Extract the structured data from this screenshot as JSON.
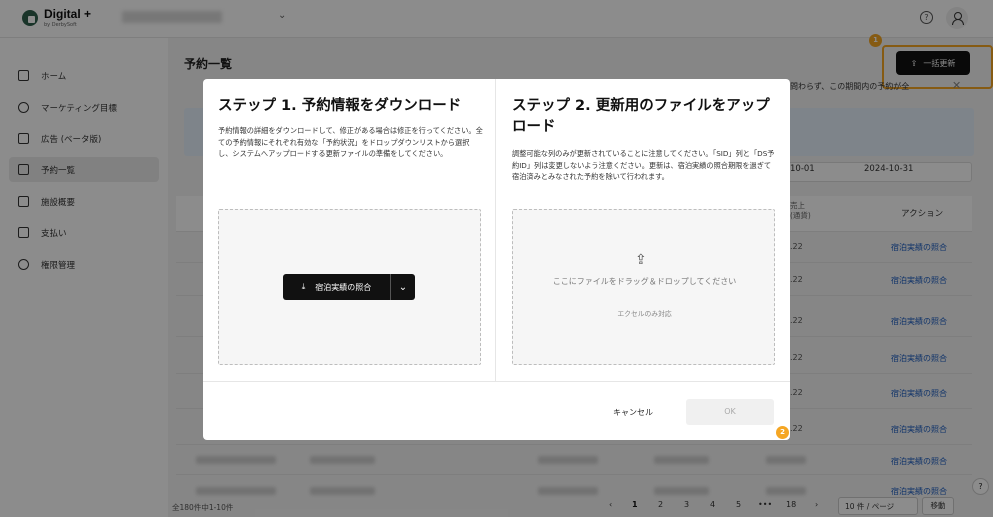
{
  "app": {
    "name": "Digital +",
    "by": "by DerbySoft"
  },
  "sidebar": {
    "items": [
      {
        "label": "ホーム"
      },
      {
        "label": "マーケティング目標"
      },
      {
        "label": "広告 (ベータ版)"
      },
      {
        "label": "予約一覧"
      },
      {
        "label": "施設概要"
      },
      {
        "label": "支払い"
      },
      {
        "label": "権限管理"
      }
    ]
  },
  "page": {
    "title": "予約一覧",
    "bulk_update_label": "一括更新",
    "notice_tail": "問わらず、この期間内の予約が全",
    "date_start_tail": "10-01",
    "date_end": "2024-10-31",
    "col_sales_line1": "売上",
    "col_sales_line2": "(通貨)",
    "col_action": "アクション",
    "row_sales": ".22",
    "row_action": "宿泊実績の照合",
    "total_count": "全180件中1-10件",
    "pager": [
      "1",
      "2",
      "3",
      "4",
      "5",
      "•••",
      "18"
    ],
    "page_size": "10 件 / ページ",
    "go_label": "移動"
  },
  "annotations": {
    "badge1": "1",
    "badge2": "2"
  },
  "modal": {
    "step1": {
      "title": "ステップ 1. 予約情報をダウンロード",
      "desc": "予約情報の詳細をダウンロードして、修正がある場合は修正を行ってください。全ての予約情報にそれぞれ有効な「予約状況」をドロップダウンリストから選択し、システムへアップロードする更新ファイルの準備をしてください。",
      "button_label": "宿泊実績の照合"
    },
    "step2": {
      "title": "ステップ 2. 更新用のファイルをアップロード",
      "desc": "調整可能な列のみが更新されていることに注意してください。「SID」列と「DS予約ID」列は変更しないよう注意ください。更新は、宿泊実績の照合期限を過ぎて宿泊済みとみなされた予約を除いて行われます。",
      "drop_text": "ここにファイルをドラッグ＆ドロップしてください",
      "drop_sub": "エクセルのみ対応"
    },
    "cancel_label": "キャンセル",
    "ok_label": "OK"
  }
}
